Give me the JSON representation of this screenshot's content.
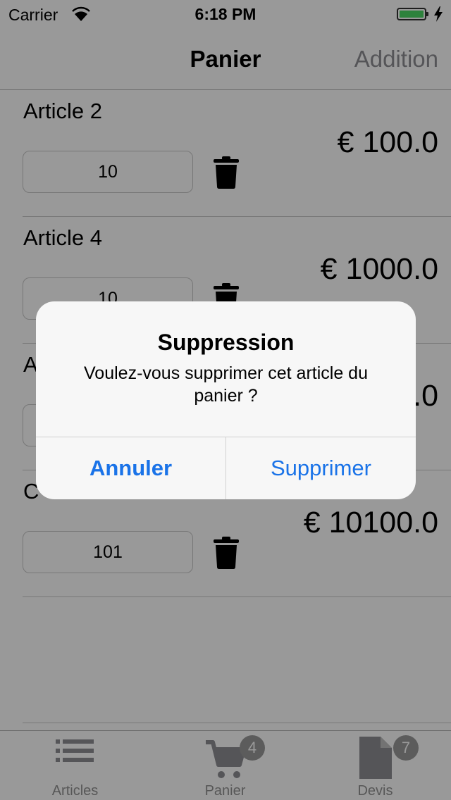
{
  "status_bar": {
    "carrier": "Carrier",
    "time": "6:18 PM"
  },
  "nav": {
    "title": "Panier",
    "right_button": "Addition"
  },
  "cart": {
    "items": [
      {
        "title": "Article 2",
        "quantity": "10",
        "price": "€ 100.0"
      },
      {
        "title": "Article 4",
        "quantity": "10",
        "price": "€ 1000.0"
      },
      {
        "title": "A",
        "quantity": "",
        "price": ".0"
      },
      {
        "title": "C",
        "quantity": "101",
        "price": "€ 10100.0"
      }
    ]
  },
  "tabs": [
    {
      "label": "Articles",
      "icon": "list-icon",
      "badge": ""
    },
    {
      "label": "Panier",
      "icon": "cart-icon",
      "badge": "4"
    },
    {
      "label": "Devis",
      "icon": "document-icon",
      "badge": "7"
    }
  ],
  "alert": {
    "title": "Suppression",
    "message": "Voulez-vous supprimer cet article du panier ?",
    "cancel": "Annuler",
    "confirm": "Supprimer"
  },
  "colors": {
    "accent": "#1a73e8",
    "battery": "#4cd964",
    "badge": "#9a9a9a"
  }
}
